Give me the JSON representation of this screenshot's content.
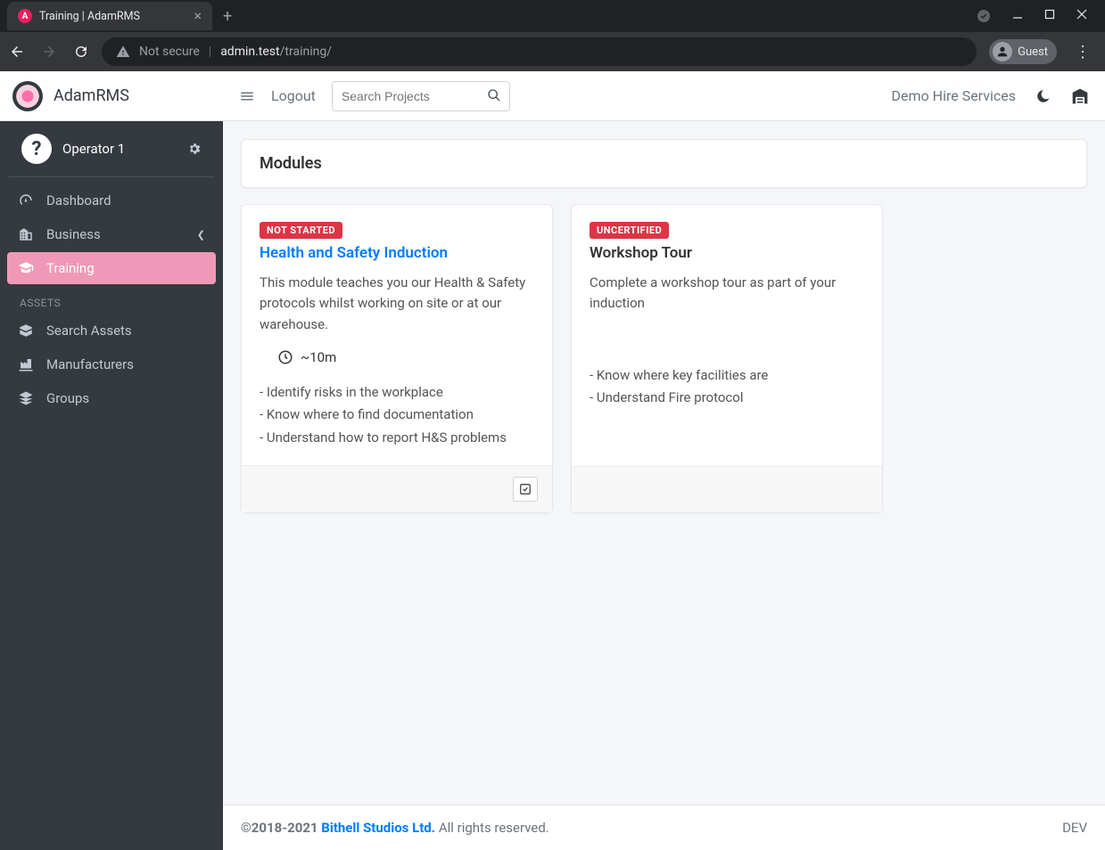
{
  "browser": {
    "tab_title": "Training | AdamRMS",
    "not_secure": "Not secure",
    "url_host": "admin.test",
    "url_path": "/training/",
    "guest_label": "Guest"
  },
  "brand": {
    "name": "AdamRMS"
  },
  "user": {
    "name": "Operator 1"
  },
  "sidebar": {
    "items": [
      {
        "label": "Dashboard"
      },
      {
        "label": "Business"
      },
      {
        "label": "Training"
      }
    ],
    "assets_header": "ASSETS",
    "assets": [
      {
        "label": "Search Assets"
      },
      {
        "label": "Manufacturers"
      },
      {
        "label": "Groups"
      }
    ]
  },
  "topbar": {
    "logout": "Logout",
    "search_placeholder": "Search Projects",
    "company": "Demo Hire Services"
  },
  "page": {
    "title": "Modules"
  },
  "modules": [
    {
      "badge": "NOT STARTED",
      "title": "Health and Safety Induction",
      "link": true,
      "desc": "This module teaches you our Health & Safety protocols whilst working on site or at our warehouse.",
      "duration": "~10m",
      "bullets": [
        "- Identify risks in the workplace",
        "- Know where to find documentation",
        "- Understand how to report H&S problems"
      ],
      "has_check": true
    },
    {
      "badge": "UNCERTIFIED",
      "title": "Workshop Tour",
      "link": false,
      "desc": "Complete a workshop tour as part of your induction",
      "duration": null,
      "bullets": [
        "- Know where key facilities are",
        "- Understand Fire protocol"
      ],
      "has_check": false
    }
  ],
  "footer": {
    "copyright": "©2018-2021 ",
    "company": "Bithell Studios Ltd.",
    "rights": " All rights reserved.",
    "env": "DEV"
  }
}
